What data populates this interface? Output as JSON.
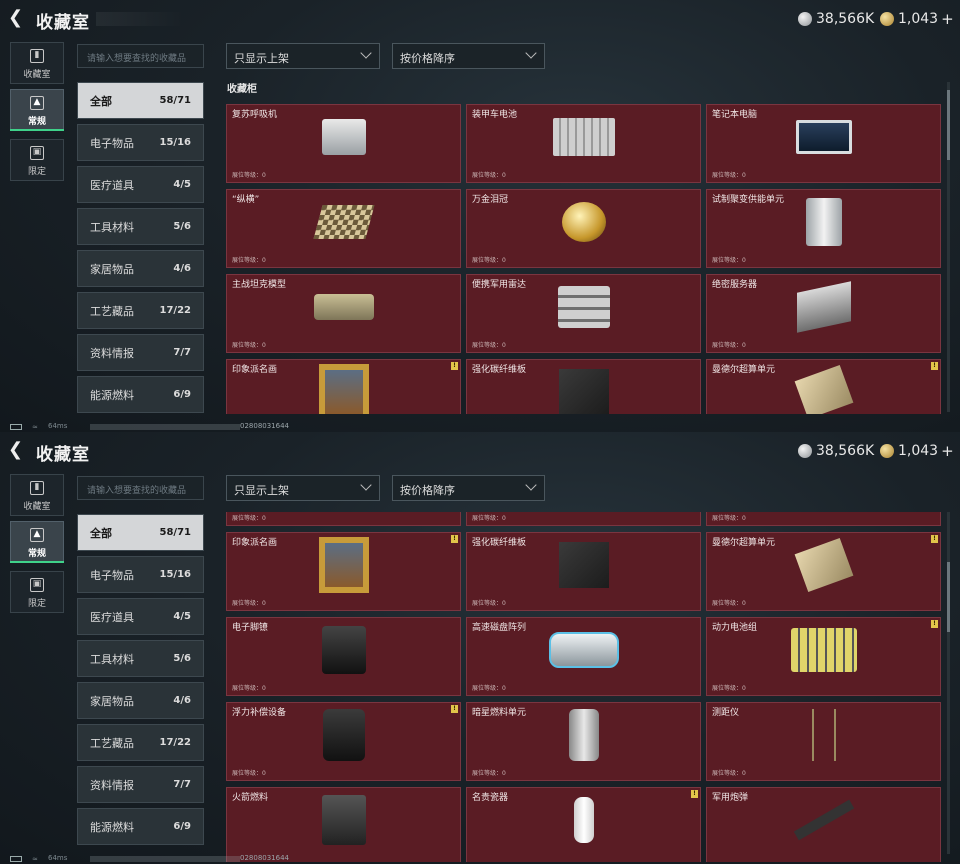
{
  "header": {
    "title": "收藏室",
    "silver": "38,566K",
    "gold": "1,043",
    "plus": "+"
  },
  "side_tabs": [
    {
      "label": "收藏室",
      "icon": "badge-icon"
    },
    {
      "label": "常规",
      "icon": "image-icon"
    },
    {
      "label": "限定",
      "icon": "image-frame-icon"
    }
  ],
  "search": {
    "placeholder": "请输入想要查找的收藏品"
  },
  "filters": {
    "shelf": "只显示上架",
    "sort": "按价格降序"
  },
  "categories": [
    {
      "label": "全部",
      "count": "58/71"
    },
    {
      "label": "电子物品",
      "count": "15/16"
    },
    {
      "label": "医疗道具",
      "count": "4/5"
    },
    {
      "label": "工具材料",
      "count": "5/6"
    },
    {
      "label": "家居物品",
      "count": "4/6"
    },
    {
      "label": "工艺藏品",
      "count": "17/22"
    },
    {
      "label": "资料情报",
      "count": "7/7"
    },
    {
      "label": "能源燃料",
      "count": "6/9"
    }
  ],
  "section_title": "收藏柜",
  "level_text": "展位等级：0",
  "items1": [
    {
      "name": "复苏呼吸机",
      "level": "展位等级：0"
    },
    {
      "name": "装甲车电池",
      "level": "展位等级：0"
    },
    {
      "name": "笔记本电脑",
      "level": "展位等级：0"
    },
    {
      "name": "“纵横”",
      "level": "展位等级：0"
    },
    {
      "name": "万金泪冠",
      "level": "展位等级：0"
    },
    {
      "name": "试制聚变供能单元",
      "level": "展位等级：0"
    },
    {
      "name": "主战坦克模型",
      "level": "展位等级：0"
    },
    {
      "name": "便携军用雷达",
      "level": "展位等级：0"
    },
    {
      "name": "绝密服务器",
      "level": "展位等级：0"
    },
    {
      "name": "印象派名画",
      "level": "",
      "flag": "!"
    },
    {
      "name": "强化碳纤维板",
      "level": ""
    },
    {
      "name": "曼德尔超算单元",
      "level": "",
      "flag": "!"
    }
  ],
  "items2_top": [
    "展位等级：0",
    "展位等级：0",
    "展位等级：0"
  ],
  "items2": [
    {
      "name": "印象派名画",
      "level": "展位等级：0",
      "flag": "!"
    },
    {
      "name": "强化碳纤维板",
      "level": "展位等级：0"
    },
    {
      "name": "曼德尔超算单元",
      "level": "展位等级：0",
      "flag": "!"
    },
    {
      "name": "电子脚镣",
      "level": "展位等级：0"
    },
    {
      "name": "高速磁盘阵列",
      "level": "展位等级：0"
    },
    {
      "name": "动力电池组",
      "level": "展位等级：0",
      "flag": "!"
    },
    {
      "name": "浮力补偿设备",
      "level": "展位等级：0",
      "flag": "!"
    },
    {
      "name": "暗星燃料单元",
      "level": "展位等级：0"
    },
    {
      "name": "测距仪",
      "level": "展位等级：0"
    },
    {
      "name": "火箭燃料",
      "level": ""
    },
    {
      "name": "名贵瓷器",
      "level": "",
      "flag": "!"
    },
    {
      "name": "军用炮弹",
      "level": ""
    }
  ],
  "status": {
    "ping": "64ms",
    "id": "02808031644"
  },
  "colors": {
    "card_bg": "#5a1c24",
    "active_accent": "#3fd28a"
  }
}
